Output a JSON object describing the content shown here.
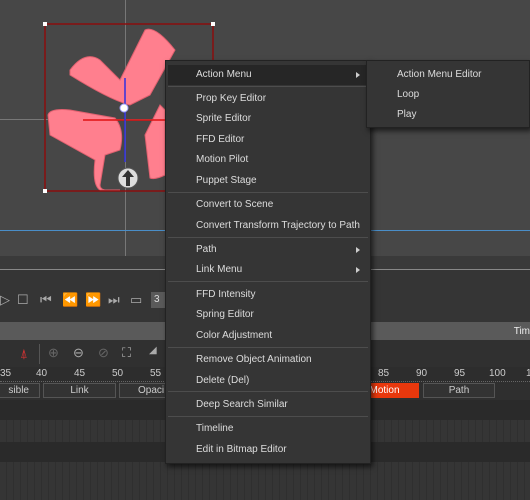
{
  "timeline_header": {
    "title": "Tim"
  },
  "playback": {
    "frame_field": "3"
  },
  "ruler_ticks": [
    "35",
    "40",
    "45",
    "50",
    "55",
    "85",
    "90",
    "95",
    "100",
    "1"
  ],
  "tracks": {
    "visible": "sible",
    "link": "Link",
    "opacity": "Opaci",
    "motion": "Motion",
    "path": "Path"
  },
  "colors": {
    "motion_track": "#e8380d",
    "shape": "#ff7f8e",
    "selection_box": "#8a0f0f"
  },
  "context_menu": {
    "items": [
      {
        "label": "Action Menu",
        "submenu": true
      },
      {
        "label": "Prop Key Editor"
      },
      {
        "label": "Sprite Editor"
      },
      {
        "label": "FFD Editor"
      },
      {
        "label": "Motion Pilot"
      },
      {
        "label": "Puppet Stage"
      },
      {
        "label": "Convert to Scene"
      },
      {
        "label": "Convert Transform Trajectory to Path"
      },
      {
        "label": "Path",
        "submenu": true
      },
      {
        "label": "Link Menu",
        "submenu": true
      },
      {
        "label": "FFD Intensity"
      },
      {
        "label": "Spring Editor"
      },
      {
        "label": "Color Adjustment"
      },
      {
        "label": "Remove Object Animation"
      },
      {
        "label": "Delete (Del)"
      },
      {
        "label": "Deep Search Similar"
      },
      {
        "label": "Timeline"
      },
      {
        "label": "Edit in Bitmap Editor"
      }
    ]
  },
  "submenu": {
    "items": [
      {
        "label": "Action Menu Editor"
      },
      {
        "label": "Loop"
      },
      {
        "label": "Play"
      }
    ]
  }
}
